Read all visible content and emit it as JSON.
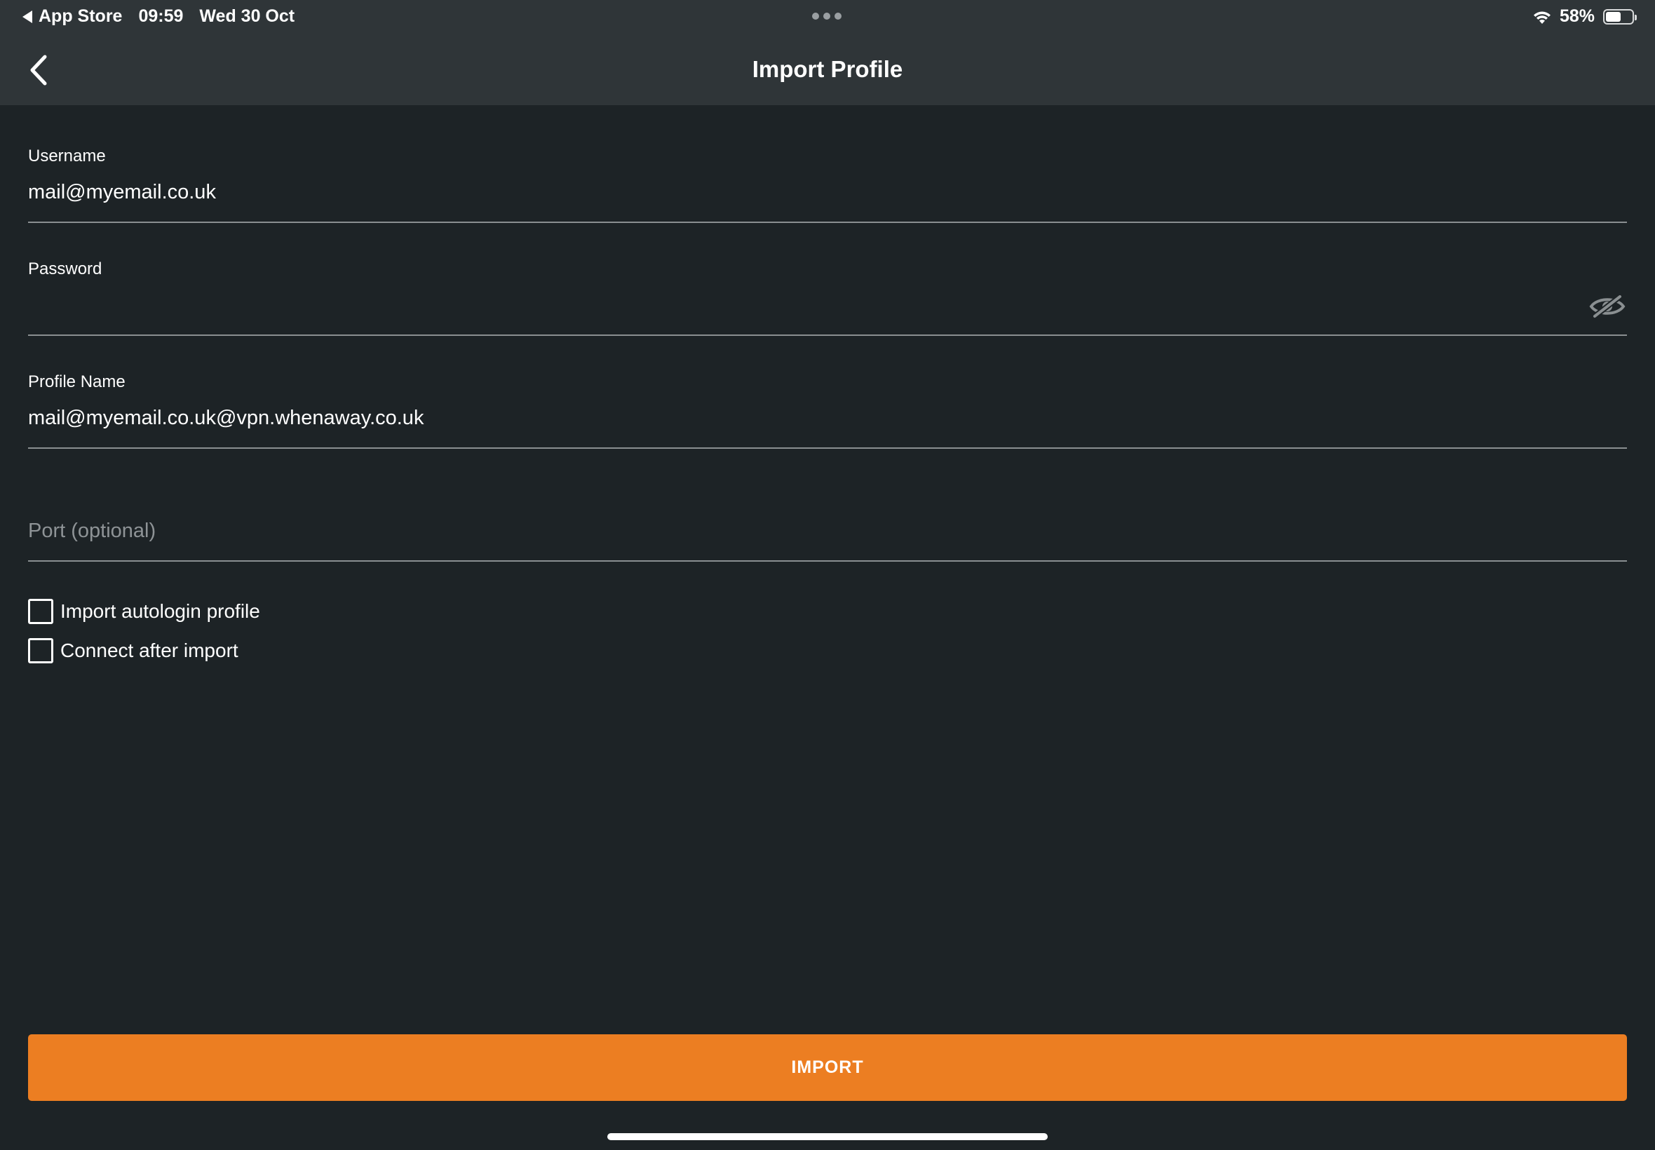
{
  "status_bar": {
    "back_app": "App Store",
    "time": "09:59",
    "date": "Wed 30 Oct",
    "battery": "58%",
    "battery_level": 0.58,
    "icons": [
      "back-triangle-icon",
      "wifi-icon",
      "battery-icon"
    ]
  },
  "nav": {
    "title": "Import Profile",
    "back_icon": "chevron-left-icon"
  },
  "form": {
    "username": {
      "label": "Username",
      "value": "mail@myemail.co.uk"
    },
    "password": {
      "label": "Password",
      "value": "",
      "toggle_icon": "eye-slash-icon"
    },
    "profile_name": {
      "label": "Profile Name",
      "value": "mail@myemail.co.uk@vpn.whenaway.co.uk"
    },
    "port": {
      "placeholder": "Port (optional)",
      "value": ""
    }
  },
  "options": [
    {
      "label": "Import autologin profile",
      "checked": false
    },
    {
      "label": "Connect after import",
      "checked": false
    }
  ],
  "import_button": "IMPORT",
  "colors": {
    "background": "#1d2326",
    "bar": "#2f3538",
    "accent": "#ec7e22"
  }
}
